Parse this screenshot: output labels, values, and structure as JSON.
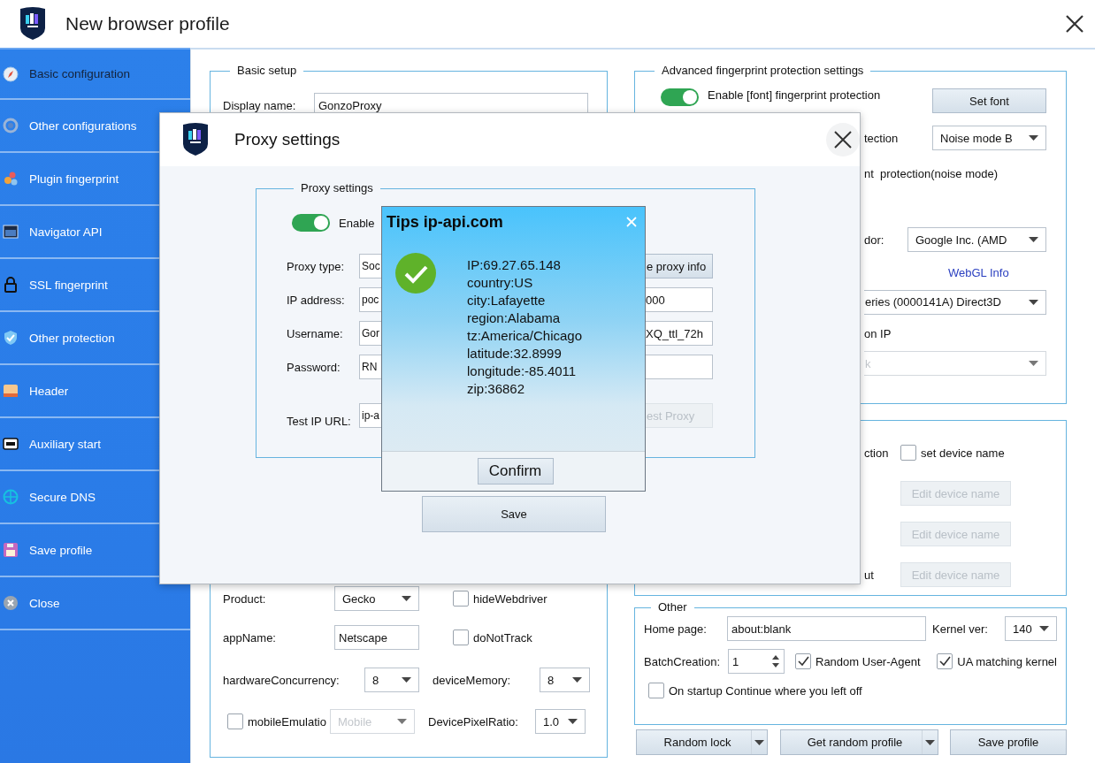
{
  "window": {
    "title": "New browser profile"
  },
  "sidebar": {
    "items": [
      {
        "label": "Basic configuration",
        "selected": true
      },
      {
        "label": "Other configurations",
        "selected": false
      },
      {
        "label": "Plugin fingerprint",
        "selected": false
      },
      {
        "label": "Navigator API",
        "selected": false
      },
      {
        "label": "SSL fingerprint",
        "selected": false
      },
      {
        "label": "Other protection",
        "selected": false
      },
      {
        "label": "Header",
        "selected": false
      },
      {
        "label": "Auxiliary start",
        "selected": false
      },
      {
        "label": "Secure DNS",
        "selected": false
      },
      {
        "label": "Save profile",
        "selected": false
      },
      {
        "label": "Close",
        "selected": false
      }
    ]
  },
  "basic_setup": {
    "title": "Basic setup",
    "display_name": {
      "label": "Display name:",
      "value": "GonzoProxy"
    },
    "rows": [
      [
        {
          "kind": "label",
          "text": "Product:"
        },
        {
          "kind": "select",
          "value": "Gecko",
          "disabled": false
        },
        {
          "kind": "checkbox",
          "label": "hideWebdriver",
          "checked": false
        }
      ],
      [
        {
          "kind": "label",
          "text": "appName:"
        },
        {
          "kind": "field",
          "value": "Netscape"
        },
        {
          "kind": "checkbox",
          "label": "doNotTrack",
          "checked": false
        }
      ],
      [
        {
          "kind": "label",
          "text": "hardwareConcurrency:"
        },
        {
          "kind": "select",
          "value": "8",
          "disabled": false
        },
        {
          "kind": "label",
          "text": "deviceMemory:"
        },
        {
          "kind": "select",
          "value": "8",
          "disabled": false
        }
      ],
      [
        {
          "kind": "checkbox",
          "label": "mobileEmulatio",
          "checked": false
        },
        {
          "kind": "select",
          "value": "Mobile",
          "disabled": true
        },
        {
          "kind": "label",
          "text": "DevicePixelRatio:"
        },
        {
          "kind": "select",
          "value": "1.0",
          "disabled": false
        }
      ]
    ]
  },
  "advanced": {
    "title": "Advanced fingerprint protection settings",
    "rows": [
      [
        {
          "kind": "toggle",
          "on": true
        },
        {
          "kind": "text",
          "text": "Enable [font] fingerprint protection"
        },
        {
          "kind": "button",
          "label": "Set font",
          "disabled": false
        }
      ],
      [
        {
          "kind": "text",
          "text": "tection"
        },
        {
          "kind": "select",
          "value": "Noise mode B",
          "disabled": false
        }
      ],
      [
        {
          "kind": "text",
          "text": "nt  protection(noise mode)"
        }
      ],
      [
        {
          "kind": "text",
          "text": "dor:"
        },
        {
          "kind": "select",
          "value": "Google Inc. (AMD",
          "disabled": false
        }
      ],
      [
        {
          "kind": "link",
          "text": "WebGL Info"
        }
      ],
      [
        {
          "kind": "select",
          "value": "eries (0000141A) Direct3D",
          "disabled": false
        }
      ],
      [
        {
          "kind": "text",
          "text": "on IP"
        }
      ],
      [
        {
          "kind": "select",
          "value": "k",
          "disabled": true
        }
      ]
    ]
  },
  "device": {
    "rows": [
      [
        {
          "kind": "text",
          "text": "ction"
        },
        {
          "kind": "checkbox",
          "label": "set device name",
          "checked": false
        }
      ],
      [
        {
          "kind": "button",
          "label": "Edit device name",
          "disabled": true
        }
      ],
      [
        {
          "kind": "button",
          "label": "Edit device name",
          "disabled": true
        }
      ],
      [
        {
          "kind": "text",
          "text": "ut"
        },
        {
          "kind": "button",
          "label": "Edit device name",
          "disabled": true
        }
      ]
    ]
  },
  "other": {
    "title": "Other",
    "rows": [
      [
        {
          "kind": "label",
          "text": "Home page:"
        },
        {
          "kind": "field",
          "value": "about:blank"
        },
        {
          "kind": "label",
          "text": "Kernel ver:"
        },
        {
          "kind": "select",
          "value": "140",
          "disabled": false
        }
      ],
      [
        {
          "kind": "label",
          "text": "BatchCreation:"
        },
        {
          "kind": "spinner",
          "value": "1"
        },
        {
          "kind": "checkbox",
          "label": "Random User-Agent",
          "checked": true
        },
        {
          "kind": "checkbox",
          "label": "UA matching kernel",
          "checked": true
        }
      ],
      [
        {
          "kind": "checkbox",
          "label": "On startup Continue where you left off",
          "checked": false
        }
      ]
    ]
  },
  "actions": [
    {
      "kind": "split",
      "label": "Random lock"
    },
    {
      "kind": "split",
      "label": "Get random profile"
    },
    {
      "kind": "button",
      "label": "Save profile"
    }
  ],
  "proxy_dialog": {
    "title": "Proxy settings",
    "section": {
      "title": "Proxy settings",
      "toggle": {
        "label": "Enable",
        "on": true
      },
      "rows": [
        {
          "label": "Proxy type:",
          "left": "Soc",
          "right": {
            "kind": "button",
            "label": "e proxy info",
            "disabled": false
          }
        },
        {
          "label": "IP address:",
          "left": "poc",
          "right": {
            "kind": "field",
            "value": "000"
          }
        },
        {
          "label": "Username:",
          "left": "Gor",
          "right": {
            "kind": "field",
            "value": "XQ_ttl_72h"
          }
        },
        {
          "label": "Password:",
          "left": "RN",
          "right": {
            "kind": "field"
          }
        },
        {
          "label": "Test IP URL:",
          "left": "ip-a",
          "right": {
            "kind": "button",
            "label": "est Proxy",
            "disabled": true
          }
        }
      ]
    },
    "save": "Save"
  },
  "tips_dialog": {
    "title": "Tips ip-api.com",
    "lines": [
      "IP:69.27.65.148",
      "country:US",
      "city:Lafayette",
      "region:Alabama",
      "tz:America/Chicago",
      "latitude:32.8999",
      "longitude:-85.4011",
      "zip:36862"
    ],
    "confirm": "Confirm"
  }
}
